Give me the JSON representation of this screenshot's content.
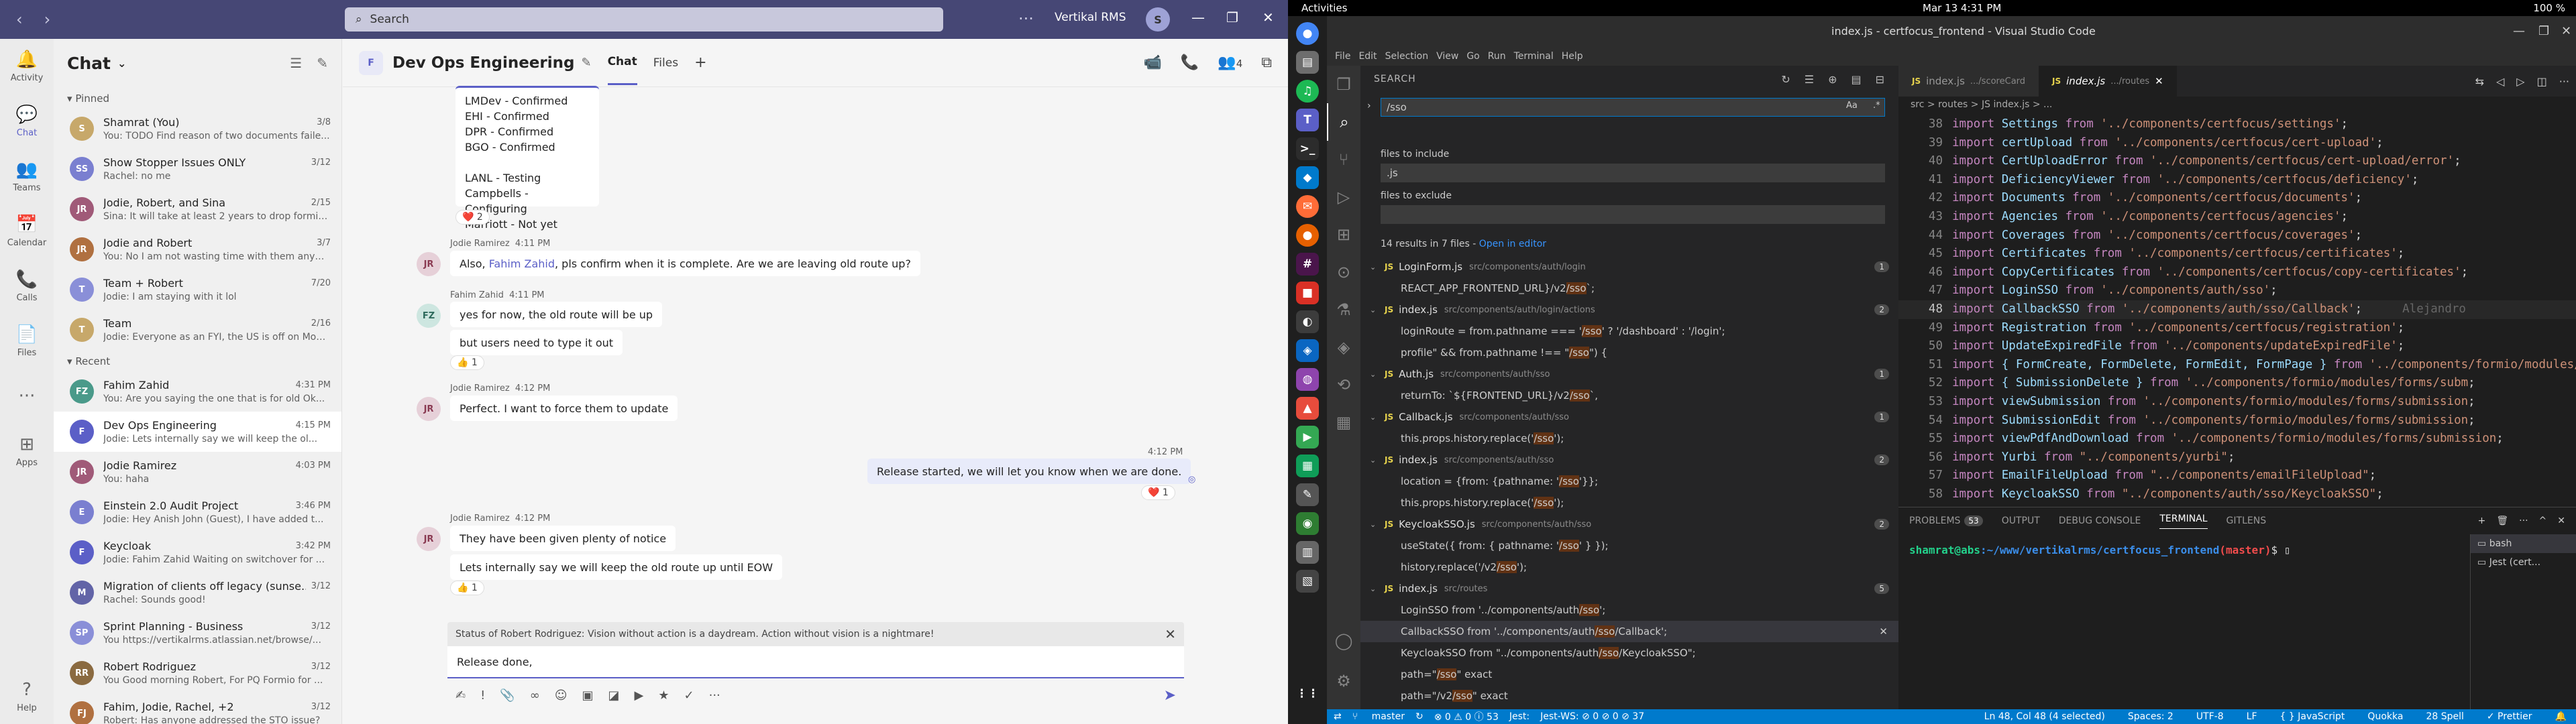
{
  "teams": {
    "search_placeholder": "Search",
    "org": "Vertikal RMS",
    "avatar": "S",
    "rail": [
      {
        "label": "Activity",
        "icon": "bell-icon"
      },
      {
        "label": "Chat",
        "icon": "chat-icon"
      },
      {
        "label": "Teams",
        "icon": "teams-icon"
      },
      {
        "label": "Calendar",
        "icon": "calendar-icon"
      },
      {
        "label": "Calls",
        "icon": "phone-icon"
      },
      {
        "label": "Files",
        "icon": "file-icon"
      },
      {
        "label": "",
        "icon": "more-icon"
      },
      {
        "label": "Apps",
        "icon": "apps-icon"
      },
      {
        "label": "Help",
        "icon": "help-icon"
      }
    ],
    "list_title": "Chat",
    "pinned_label": "Pinned",
    "recent_label": "Recent",
    "pinned": [
      {
        "name": "Shamrat (You)",
        "time": "3/8",
        "preview": "You: TODO Find reason of two documents faile...",
        "initials": "S",
        "color": "#c7a86a"
      },
      {
        "name": "Show Stopper Issues ONLY",
        "time": "3/12",
        "preview": "Rachel: no me",
        "initials": "SS",
        "color": "#7a7fd0"
      },
      {
        "name": "Jodie, Robert, and Sina",
        "time": "2/15",
        "preview": "Sina: It will take at least 2 years to drop formiO...",
        "initials": "JR",
        "color": "#a05a78"
      },
      {
        "name": "Jodie and Robert",
        "time": "3/7",
        "preview": "You: No I am not wasting time with them anym...",
        "initials": "JR",
        "color": "#b07040"
      },
      {
        "name": "Team + Robert",
        "time": "7/20",
        "preview": "Jodie: I am staying with it lol",
        "initials": "T",
        "color": "#8a8fd8"
      },
      {
        "name": "Team",
        "time": "2/16",
        "preview": "Jodie: Everyone as an FYI, the US is off on Mon...",
        "initials": "T",
        "color": "#c7a86a"
      }
    ],
    "recent": [
      {
        "name": "Fahim Zahid",
        "time": "4:31 PM",
        "preview": "You: Are you saying the one that is for old Ok...",
        "initials": "FZ",
        "color": "#4a9a8a"
      },
      {
        "name": "Dev Ops Engineering",
        "time": "4:15 PM",
        "preview": "Jodie: Lets internally say we will keep the ol...",
        "initials": "F",
        "color": "#5b5fc7",
        "active": true
      },
      {
        "name": "Jodie Ramirez",
        "time": "4:03 PM",
        "preview": "You: haha",
        "initials": "JR",
        "color": "#a05a78"
      },
      {
        "name": "Einstein 2.0 Audit Project",
        "time": "3:46 PM",
        "preview": "Jodie: Hey Anish John (Guest), I have added t...",
        "initials": "E",
        "color": "#7a7fd0"
      },
      {
        "name": "Keycloak",
        "time": "3:42 PM",
        "preview": "Jodie: Fahim Zahid Waiting on switchover for ...",
        "initials": "F",
        "color": "#5b5fc7"
      },
      {
        "name": "Migration of clients off legacy (sunse...",
        "time": "3/12",
        "preview": "Rachel: Sounds good!",
        "initials": "M",
        "color": "#6264a7"
      },
      {
        "name": "Sprint Planning - Business",
        "time": "3/12",
        "preview": "You https://vertikalrms.atlassian.net/browse/...",
        "initials": "SP",
        "color": "#8a8fd8"
      },
      {
        "name": "Robert Rodriguez",
        "time": "3/12",
        "preview": "You Good morning Robert, For PQ Formio for ...",
        "initials": "RR",
        "color": "#8a6a40"
      },
      {
        "name": "Fahim, Jodie, Rachel, +2",
        "time": "3/12",
        "preview": "Robert: Has anyone addressed the STO issue?",
        "initials": "FJ",
        "color": "#b07040"
      }
    ],
    "chat_title": "Dev Ops Engineering",
    "chat_initial": "F",
    "tab_chat": "Chat",
    "tab_files": "Files",
    "participants": "4",
    "msg1_lines": [
      "LMDev - Confirmed",
      "EHI - Confirmed",
      "DPR - Confirmed",
      "BGO - Confirmed",
      "",
      "LANL - Testing",
      "Campbells - Configuring",
      "Marriott - Not yet"
    ],
    "msg1_react": "2",
    "m2_author": "Jodie Ramirez",
    "m2_time": "4:11 PM",
    "m2_pre": "Also, ",
    "m2_mention": "Fahim Zahid",
    "m2_post": ", pls confirm when it is complete.  Are we are leaving old route up?",
    "m3_author": "Fahim Zahid",
    "m3_time": "4:11 PM",
    "m3_a": "yes for now, the old route will be up",
    "m3_b": "but users need to type it out",
    "m3_react": "1",
    "m4_author": "Jodie Ramirez",
    "m4_time": "4:12 PM",
    "m4_text": "Perfect.  I want to force them to update",
    "m5_time": "4:12 PM",
    "m5_text": "Release started, we will let you know when we are done.",
    "m5_react": "1",
    "m6_author": "Jodie Ramirez",
    "m6_time": "4:12 PM",
    "m6_a": "They have been given plenty of notice",
    "m6_b": "Lets internally say we will keep the old route up until EOW",
    "m6_react": "1",
    "status_text": "Status of Robert Rodriguez: Vision without action is a daydream. Action without vision is a nightmare!",
    "compose_text": "Release done,"
  },
  "ubuntu": {
    "activities": "Activities",
    "clock": "Mar 13  4:31 PM",
    "tray": "100 %"
  },
  "vscode": {
    "title": "index.js - certfocus_frontend - Visual Studio Code",
    "menu": [
      "File",
      "Edit",
      "Selection",
      "View",
      "Go",
      "Run",
      "Terminal",
      "Help"
    ],
    "search_header": "SEARCH",
    "search_value": "/sso",
    "include_label": "files to include",
    "include_value": ".js",
    "exclude_label": "files to exclude",
    "result_summary": "14 results in 7 files - ",
    "open_editor": "Open in editor",
    "results": [
      {
        "file": "LoginForm.js",
        "path": "src/components/auth/login",
        "count": "1",
        "matches": [
          {
            "pre": "REACT_APP_FRONTEND_URL}/v2",
            "hl": "/sso",
            "post": "`;"
          }
        ]
      },
      {
        "file": "index.js",
        "path": "src/components/auth/login/actions",
        "count": "2",
        "matches": [
          {
            "pre": "loginRoute = from.pathname === '",
            "hl": "/sso",
            "post": "' ? '/dashboard' : '/login';"
          },
          {
            "pre": "profile\" && from.pathname !== \"",
            "hl": "/sso",
            "post": "\") {"
          }
        ]
      },
      {
        "file": "Auth.js",
        "path": "src/components/auth/sso",
        "count": "1",
        "matches": [
          {
            "pre": "returnTo: `${FRONTEND_URL}/v2",
            "hl": "/sso",
            "post": "`,"
          }
        ]
      },
      {
        "file": "Callback.js",
        "path": "src/components/auth/sso",
        "count": "1",
        "matches": [
          {
            "pre": "this.props.history.replace('",
            "hl": "/sso",
            "post": "');"
          }
        ]
      },
      {
        "file": "index.js",
        "path": "src/components/auth/sso",
        "count": "2",
        "matches": [
          {
            "pre": "location = {from: {pathname: '",
            "hl": "/sso",
            "post": "'}};"
          },
          {
            "pre": "this.props.history.replace('",
            "hl": "/sso",
            "post": "');"
          }
        ]
      },
      {
        "file": "KeycloakSSO.js",
        "path": "src/components/auth/sso",
        "count": "2",
        "matches": [
          {
            "pre": "useState({ from: { pathname: '",
            "hl": "/sso",
            "post": "' } });"
          },
          {
            "pre": "history.replace('/v2",
            "hl": "/sso",
            "post": "');"
          }
        ]
      },
      {
        "file": "index.js",
        "path": "src/routes",
        "count": "5",
        "matches": [
          {
            "pre": "LoginSSO from '../components/auth",
            "hl": "/sso",
            "post": "';"
          },
          {
            "pre": "CallbackSSO from '../components/auth",
            "hl": "/sso",
            "post": "/Callback';",
            "sel": true
          },
          {
            "pre": "KeycloakSSO from \"../components/auth",
            "hl": "/sso",
            "post": "/KeycloakSSO\";"
          },
          {
            "pre": "path=\"",
            "hl": "/sso",
            "post": "\" exact"
          },
          {
            "pre": "path=\"/v2",
            "hl": "/sso",
            "post": "\" exact"
          }
        ]
      }
    ],
    "tab1": "index.js",
    "tab1_path": ".../scoreCard",
    "tab2": "index.js",
    "tab2_path": ".../routes",
    "breadcrumb": "src  >  routes  >  JS  index.js  >  ...",
    "code": [
      {
        "n": "38",
        "id": "Settings",
        "src": "'../components/certfocus/settings'"
      },
      {
        "n": "39",
        "id": "certUpload",
        "src": "'../components/certfocus/cert-upload'"
      },
      {
        "n": "40",
        "id": "CertUploadError",
        "src": "'../components/certfocus/cert-upload/error'"
      },
      {
        "n": "41",
        "id": "DeficiencyViewer",
        "src": "'../components/certfocus/deficiency'"
      },
      {
        "n": "42",
        "id": "Documents",
        "src": "'../components/certfocus/documents'"
      },
      {
        "n": "43",
        "id": "Agencies",
        "src": "'../components/certfocus/agencies'"
      },
      {
        "n": "44",
        "id": "Coverages",
        "src": "'../components/certfocus/coverages'"
      },
      {
        "n": "45",
        "id": "Certificates",
        "src": "'../components/certfocus/certificates'"
      },
      {
        "n": "46",
        "id": "CopyCertificates",
        "src": "'../components/certfocus/copy-certificates'"
      },
      {
        "n": "47",
        "id": "LoginSSO",
        "src": "'../components/auth/sso'"
      },
      {
        "n": "48",
        "id": "CallbackSSO",
        "src": "'../components/auth/sso/Callback'",
        "cur": true
      },
      {
        "n": "49",
        "id": "Registration",
        "src": "'../components/certfocus/registration'"
      },
      {
        "n": "50",
        "id": "UpdateExpiredFile",
        "src": "'../components/updateExpiredFile'"
      },
      {
        "n": "51",
        "id": "{ FormCreate, FormDelete, FormEdit, FormPage }",
        "src": "'../components/formio/modules/form"
      },
      {
        "n": "52",
        "id": "{ SubmissionDelete }",
        "src": "'../components/formio/modules/forms/subm"
      },
      {
        "n": "53",
        "id": "viewSubmission",
        "src": "'../components/formio/modules/forms/submission"
      },
      {
        "n": "54",
        "id": "SubmissionEdit",
        "src": "'../components/formio/modules/forms/submission"
      },
      {
        "n": "55",
        "id": "viewPdfAndDownload",
        "src": "'../components/formio/modules/forms/submission"
      },
      {
        "n": "56",
        "id": "Yurbi",
        "src": "\"../components/yurbi\""
      },
      {
        "n": "57",
        "id": "EmailFileUpload",
        "src": "\"../components/emailFileUpload\""
      },
      {
        "n": "58",
        "id": "KeycloakSSO",
        "src": "\"../components/auth/sso/KeycloakSSO\""
      }
    ],
    "blame": "Alejandro",
    "panel_tabs": [
      "PROBLEMS",
      "OUTPUT",
      "DEBUG CONSOLE",
      "TERMINAL",
      "GITLENS"
    ],
    "problems_count": "53",
    "term_user": "shamrat@abs",
    "term_path": ":~/www/vertikalrms/certfocus_frontend",
    "term_branch": "(master)",
    "term_prompt": "$ ",
    "sessions": [
      "bash",
      "Jest (cert..."
    ],
    "status": {
      "branch": "master",
      "errors": "⊗ 0 ⚠ 0 ⓘ 53",
      "jest": "Jest:",
      "jestws": "Jest-WS: ⊘ 0 ⊘ 0 ⊘ 37",
      "pos": "Ln 48, Col 48 (4 selected)",
      "spaces": "Spaces: 2",
      "enc": "UTF-8",
      "eol": "LF",
      "lang": "{ } JavaScript",
      "quokka": "Quokka",
      "ports": "28 Spell",
      "prettier": "✓ Prettier"
    }
  }
}
